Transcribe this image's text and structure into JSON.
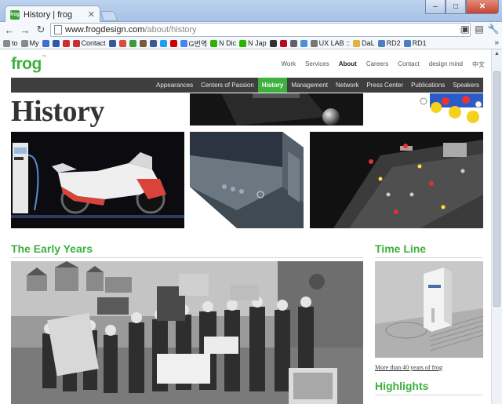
{
  "browser": {
    "tab_title": "History | frog",
    "favicon_text": "frog",
    "url_host": "www.frogdesign.com",
    "url_path": "/about/history",
    "bookmarks": [
      {
        "label": "to",
        "color": "#8a8a8a"
      },
      {
        "label": "My",
        "color": "#8a8a8a"
      },
      {
        "label": "",
        "color": "#3b6fd1"
      },
      {
        "label": "",
        "color": "#2a59b3"
      },
      {
        "label": "",
        "color": "#c83030"
      },
      {
        "label": "Contact",
        "color": "#c83030"
      },
      {
        "label": "",
        "color": "#3b5998"
      },
      {
        "label": "",
        "color": "#dd4b39"
      },
      {
        "label": "",
        "color": "#3b9b3b"
      },
      {
        "label": "",
        "color": "#7a5c3a"
      },
      {
        "label": "",
        "color": "#3b5998"
      },
      {
        "label": "",
        "color": "#1da1f2"
      },
      {
        "label": "",
        "color": "#cc0000"
      },
      {
        "label": "G번역",
        "color": "#4285f4"
      },
      {
        "label": "N Dic",
        "color": "#2db400"
      },
      {
        "label": "N Jap",
        "color": "#2db400"
      },
      {
        "label": "",
        "color": "#333333"
      },
      {
        "label": "",
        "color": "#bd081c"
      },
      {
        "label": "",
        "color": "#5f6368"
      },
      {
        "label": "",
        "color": "#4a90d9"
      },
      {
        "label": "UX LAB ::",
        "color": "#777777"
      },
      {
        "label": "DaL",
        "color": "#e2b13c"
      },
      {
        "label": "RD2",
        "color": "#4a7fc1"
      },
      {
        "label": "RD1",
        "color": "#4a7fc1"
      }
    ]
  },
  "site": {
    "logo": "frog",
    "logo_mark": "™",
    "top_nav": [
      {
        "label": "Work",
        "active": false
      },
      {
        "label": "Services",
        "active": false
      },
      {
        "label": "About",
        "active": true
      },
      {
        "label": "Careers",
        "active": false
      },
      {
        "label": "Contact",
        "active": false
      },
      {
        "label": "design mind",
        "active": false
      },
      {
        "label": "中文",
        "active": false
      }
    ],
    "sub_nav": [
      {
        "label": "Appearances",
        "active": false
      },
      {
        "label": "Centers of Passion",
        "active": false
      },
      {
        "label": "History",
        "active": true
      },
      {
        "label": "Management",
        "active": false
      },
      {
        "label": "Network",
        "active": false
      },
      {
        "label": "Press Center",
        "active": false
      },
      {
        "label": "Publications",
        "active": false
      },
      {
        "label": "Speakers",
        "active": false
      }
    ],
    "page_title": "History",
    "early_years_heading": "The Early Years",
    "timeline_heading": "Time Line",
    "timeline_link": "More than 40 years of frog",
    "highlights_heading": "Highlights"
  },
  "colors": {
    "brand_green": "#3db13d",
    "nav_dark": "#3e3e3e"
  }
}
